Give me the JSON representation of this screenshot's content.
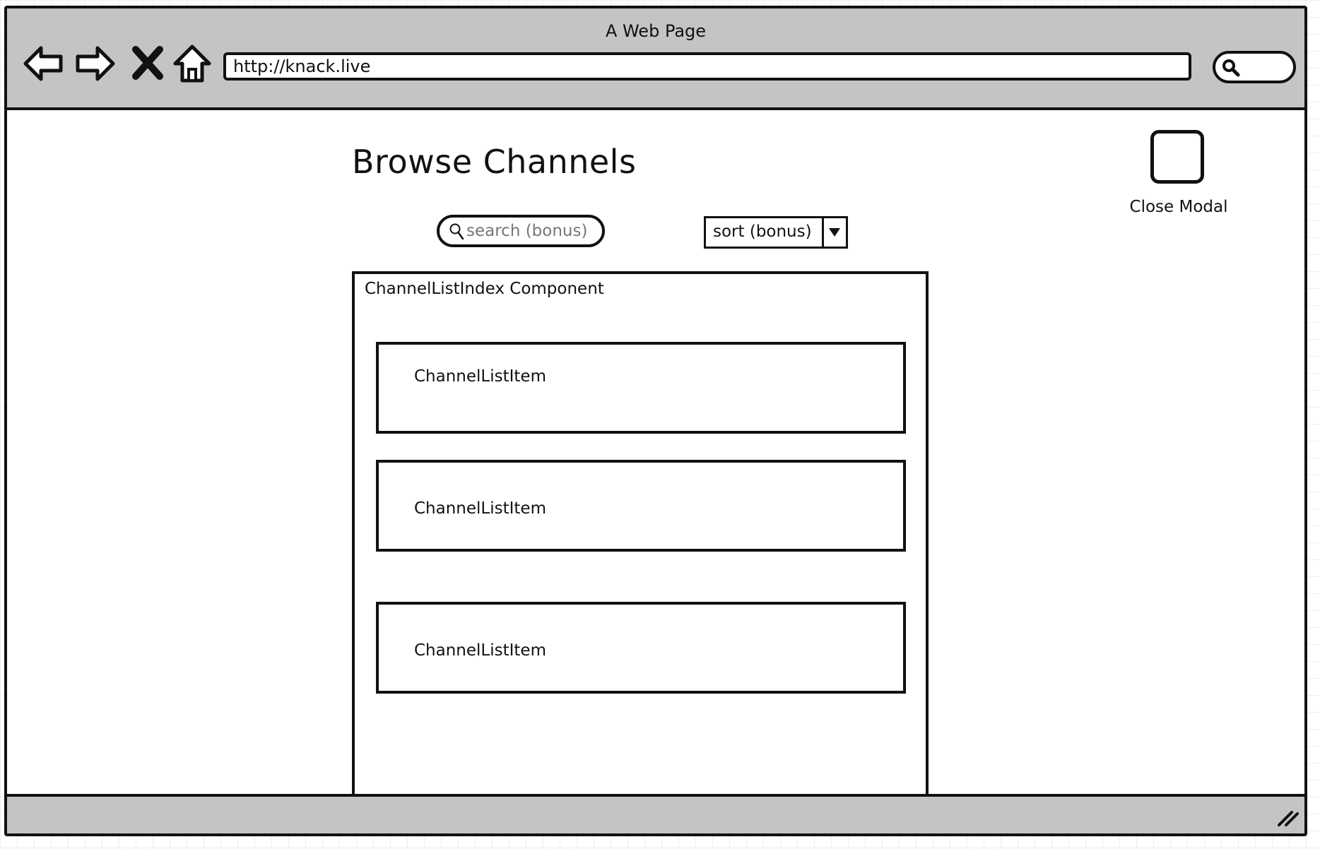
{
  "window": {
    "title": "A Web Page",
    "url": "http://knack.live"
  },
  "icons": {
    "back": "back-arrow-icon",
    "forward": "forward-arrow-icon",
    "stop": "close-x-icon",
    "home": "home-icon",
    "search": "search-icon",
    "resize": "resize-grip-icon",
    "dropdown": "chevron-down-icon"
  },
  "page": {
    "title": "Browse Channels",
    "close_modal_label": "Close Modal",
    "search_placeholder": "search (bonus)",
    "sort_label": "sort (bonus)"
  },
  "channel_list": {
    "title": "ChannelListIndex Component",
    "items": [
      {
        "label": "ChannelListItem"
      },
      {
        "label": "ChannelListItem"
      },
      {
        "label": "ChannelListItem"
      }
    ]
  }
}
